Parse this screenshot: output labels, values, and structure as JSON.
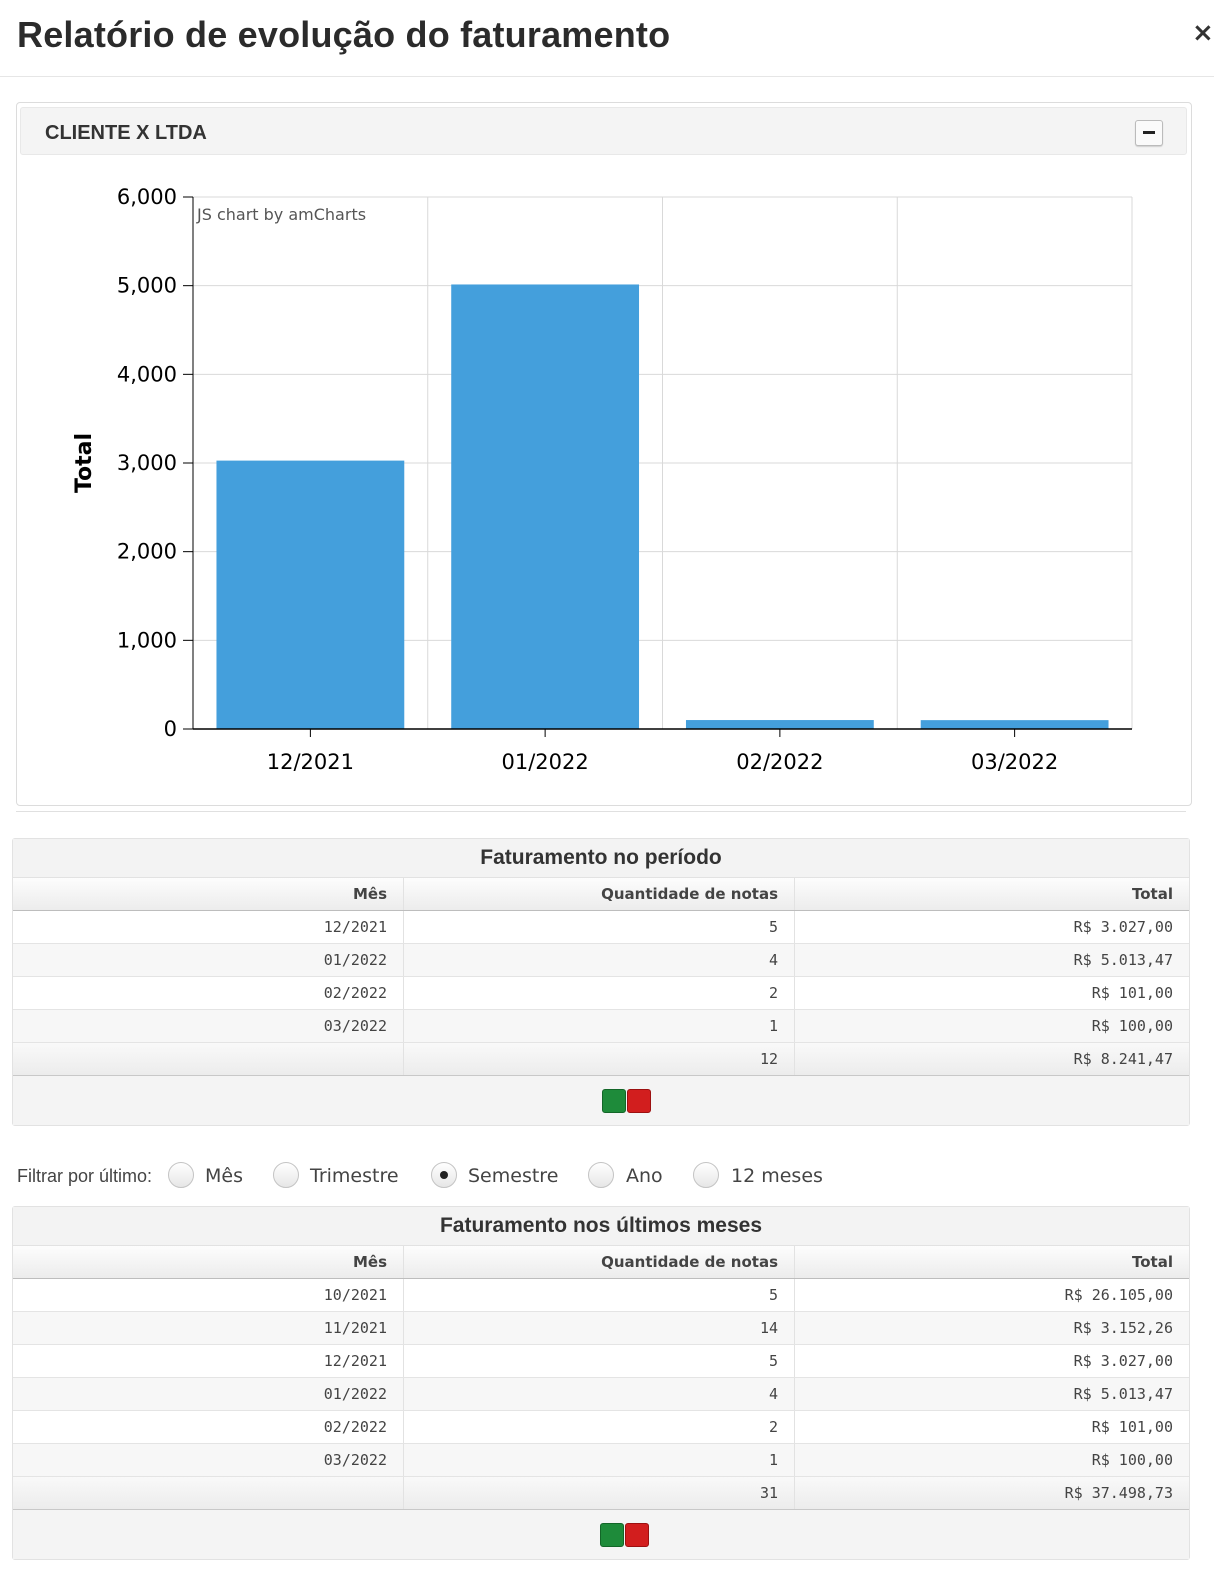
{
  "header": {
    "title": "Relatório de evolução do faturamento",
    "close_label": "×"
  },
  "panel": {
    "title": "CLIENTE X LTDA"
  },
  "chart_data": {
    "type": "bar",
    "categories": [
      "12/2021",
      "01/2022",
      "02/2022",
      "03/2022"
    ],
    "values": [
      3027.0,
      5013.47,
      101.0,
      100.0
    ],
    "ylabel": "Total",
    "ylim": [
      0,
      6000
    ],
    "yticks": [
      0,
      1000,
      2000,
      3000,
      4000,
      5000,
      6000
    ],
    "ytick_labels": [
      "0",
      "1,000",
      "2,000",
      "3,000",
      "4,000",
      "5,000",
      "6,000"
    ],
    "grid": true,
    "credit": "JS chart by amCharts",
    "bar_color": "#449fdc"
  },
  "table1": {
    "caption": "Faturamento no período",
    "columns": [
      "Mês",
      "Quantidade de notas",
      "Total"
    ],
    "rows": [
      [
        "12/2021",
        "5",
        "R$ 3.027,00"
      ],
      [
        "01/2022",
        "4",
        "R$ 5.013,47"
      ],
      [
        "02/2022",
        "2",
        "R$ 101,00"
      ],
      [
        "03/2022",
        "1",
        "R$ 100,00"
      ]
    ],
    "footer": [
      "",
      "12",
      "R$ 8.241,47"
    ]
  },
  "filter": {
    "label": "Filtrar por último:",
    "options": [
      "Mês",
      "Trimestre",
      "Semestre",
      "Ano",
      "12 meses"
    ],
    "selected": "Semestre"
  },
  "table2": {
    "caption": "Faturamento nos últimos meses",
    "columns": [
      "Mês",
      "Quantidade de notas",
      "Total"
    ],
    "rows": [
      [
        "10/2021",
        "5",
        "R$ 26.105,00"
      ],
      [
        "11/2021",
        "14",
        "R$ 3.152,26"
      ],
      [
        "12/2021",
        "5",
        "R$ 3.027,00"
      ],
      [
        "01/2022",
        "4",
        "R$ 5.013,47"
      ],
      [
        "02/2022",
        "2",
        "R$ 101,00"
      ],
      [
        "03/2022",
        "1",
        "R$ 100,00"
      ]
    ],
    "footer": [
      "",
      "31",
      "R$ 37.498,73"
    ]
  },
  "icons": {
    "export_excel": "spreadsheet-icon",
    "export_pdf": "pdf-icon"
  }
}
